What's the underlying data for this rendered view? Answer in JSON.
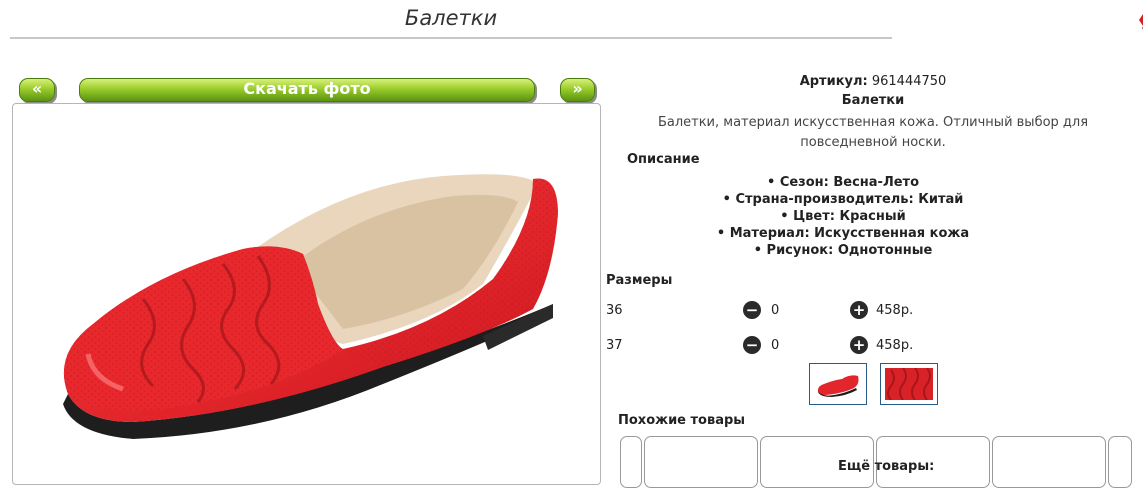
{
  "page": {
    "title": "Балетки"
  },
  "gallery": {
    "prev_label": "«",
    "next_label": "»",
    "download_label": "Скачать фото"
  },
  "product": {
    "sku_label": "Артикул:",
    "sku_value": "961444750",
    "name": "Балетки",
    "description": "Балетки, материал искусственная кожа. Отличный выбор для повседневной носки.",
    "description_heading": "Описание",
    "properties": [
      "Сезон: Весна-Лето",
      "Страна-производитель: Китай",
      "Цвет: Красный",
      "Материал: Искусственная кожа",
      "Рисунок: Однотонные"
    ]
  },
  "sizes": {
    "label": "Размеры",
    "rows": [
      {
        "size": "36",
        "qty": "0",
        "price": "458р."
      },
      {
        "size": "37",
        "qty": "0",
        "price": "458р."
      }
    ]
  },
  "similar": {
    "label": "Похожие товары"
  },
  "more": {
    "label": "Ещё товары:"
  },
  "colors": {
    "accent_green": "#7cb520",
    "shoe_red": "#e3262b",
    "thumb_border": "#2a5c8a"
  }
}
